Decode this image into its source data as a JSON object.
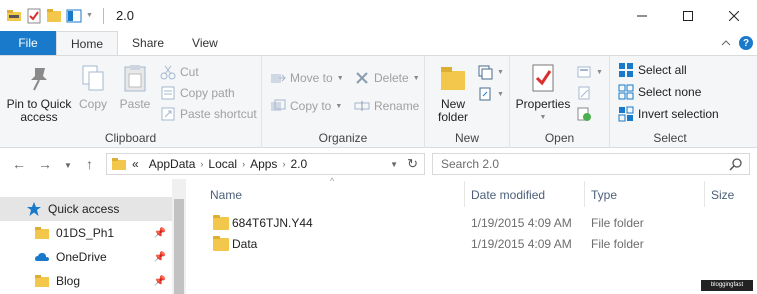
{
  "window": {
    "title": "2.0"
  },
  "ribbon_tabs": [
    "File",
    "Home",
    "Share",
    "View"
  ],
  "clipboard": {
    "pin": "Pin to Quick access",
    "copy": "Copy",
    "paste": "Paste",
    "cut": "Cut",
    "copy_path": "Copy path",
    "paste_shortcut": "Paste shortcut",
    "title": "Clipboard"
  },
  "organize": {
    "move_to": "Move to",
    "copy_to": "Copy to",
    "delete": "Delete",
    "rename": "Rename",
    "title": "Organize"
  },
  "new_group": {
    "new_folder": "New folder",
    "title": "New"
  },
  "open_group": {
    "properties": "Properties",
    "title": "Open"
  },
  "select_group": {
    "select_all": "Select all",
    "select_none": "Select none",
    "invert": "Invert selection",
    "title": "Select"
  },
  "address": {
    "overflow": "«",
    "crumbs": [
      "AppData",
      "Local",
      "Apps",
      "2.0"
    ]
  },
  "search": {
    "placeholder": "Search 2.0"
  },
  "nav": {
    "items": [
      {
        "label": "Quick access",
        "icon": "star-icon"
      },
      {
        "label": "01DS_Ph1",
        "icon": "folder-icon"
      },
      {
        "label": "OneDrive",
        "icon": "cloud-icon"
      },
      {
        "label": "Blog",
        "icon": "folder-icon"
      }
    ]
  },
  "columns": [
    "Name",
    "Date modified",
    "Type",
    "Size"
  ],
  "files": [
    {
      "name": "684T6TJN.Y44",
      "date": "1/19/2015 4:09 AM",
      "type": "File folder",
      "size": ""
    },
    {
      "name": "Data",
      "date": "1/19/2015 4:09 AM",
      "type": "File folder",
      "size": ""
    }
  ],
  "colors": {
    "accent": "#1979ca",
    "ribbon_bg": "#f5f6f7",
    "folder": "#f3c64c"
  }
}
